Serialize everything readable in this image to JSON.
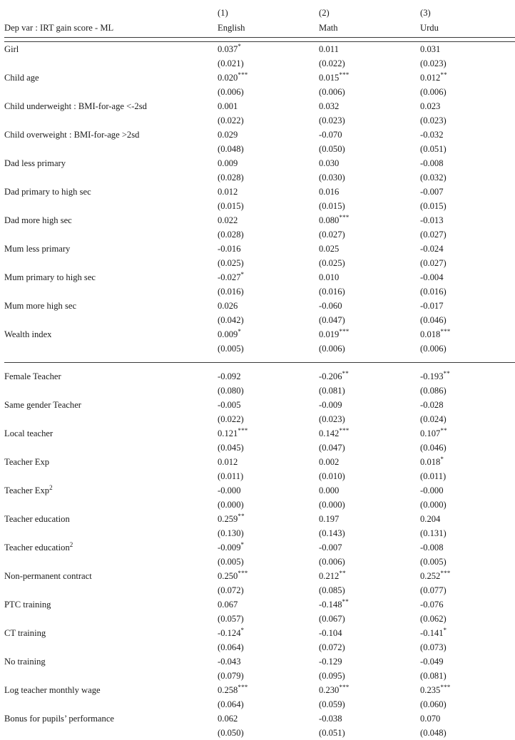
{
  "table": {
    "stub_header": "Dep var : IRT gain score - ML",
    "model_numbers": [
      "(1)",
      "(2)",
      "(3)"
    ],
    "column_headers": [
      "English",
      "Math",
      "Urdu"
    ],
    "panels": [
      {
        "name": "child-household-characteristics",
        "rows": [
          {
            "label": "Girl",
            "coefficients": [
              "0.037",
              "0.011",
              "0.031"
            ],
            "stars": [
              "*",
              "",
              ""
            ],
            "std_errors": [
              "(0.021)",
              "(0.022)",
              "(0.023)"
            ]
          },
          {
            "label": "Child age",
            "coefficients": [
              "0.020",
              "0.015",
              "0.012"
            ],
            "stars": [
              "***",
              "***",
              "**"
            ],
            "std_errors": [
              "(0.006)",
              "(0.006)",
              "(0.006)"
            ]
          },
          {
            "label": "Child underweight : BMI-for-age <-2sd",
            "coefficients": [
              "0.001",
              "0.032",
              "0.023"
            ],
            "stars": [
              "",
              "",
              ""
            ],
            "std_errors": [
              "(0.022)",
              "(0.023)",
              "(0.023)"
            ]
          },
          {
            "label": "Child overweight : BMI-for-age >2sd",
            "coefficients": [
              "0.029",
              "-0.070",
              "-0.032"
            ],
            "stars": [
              "",
              "",
              ""
            ],
            "std_errors": [
              "(0.048)",
              "(0.050)",
              "(0.051)"
            ]
          },
          {
            "label": "Dad less primary",
            "coefficients": [
              "0.009",
              "0.030",
              "-0.008"
            ],
            "stars": [
              "",
              "",
              ""
            ],
            "std_errors": [
              "(0.028)",
              "(0.030)",
              "(0.032)"
            ]
          },
          {
            "label": "Dad primary to high sec",
            "coefficients": [
              "0.012",
              "0.016",
              "-0.007"
            ],
            "stars": [
              "",
              "",
              ""
            ],
            "std_errors": [
              "(0.015)",
              "(0.015)",
              "(0.015)"
            ]
          },
          {
            "label": "Dad more high sec",
            "coefficients": [
              "0.022",
              "0.080",
              "-0.013"
            ],
            "stars": [
              "",
              "***",
              ""
            ],
            "std_errors": [
              "(0.028)",
              "(0.027)",
              "(0.027)"
            ]
          },
          {
            "label": "Mum less primary",
            "coefficients": [
              "-0.016",
              "0.025",
              "-0.024"
            ],
            "stars": [
              "",
              "",
              ""
            ],
            "std_errors": [
              "(0.025)",
              "(0.025)",
              "(0.027)"
            ]
          },
          {
            "label": "Mum primary to high sec",
            "coefficients": [
              "-0.027",
              "0.010",
              "-0.004"
            ],
            "stars": [
              "*",
              "",
              ""
            ],
            "std_errors": [
              "(0.016)",
              "(0.016)",
              "(0.016)"
            ]
          },
          {
            "label": "Mum more high sec",
            "coefficients": [
              "0.026",
              "-0.060",
              "-0.017"
            ],
            "stars": [
              "",
              "",
              ""
            ],
            "std_errors": [
              "(0.042)",
              "(0.047)",
              "(0.046)"
            ]
          },
          {
            "label": "Wealth index",
            "coefficients": [
              "0.009",
              "0.019",
              "0.018"
            ],
            "stars": [
              "*",
              "***",
              "***"
            ],
            "std_errors": [
              "(0.005)",
              "(0.006)",
              "(0.006)"
            ]
          }
        ]
      },
      {
        "name": "teacher-characteristics",
        "rows": [
          {
            "label": "Female Teacher",
            "coefficients": [
              "-0.092",
              "-0.206",
              "-0.193"
            ],
            "stars": [
              "",
              "**",
              "**"
            ],
            "std_errors": [
              "(0.080)",
              "(0.081)",
              "(0.086)"
            ]
          },
          {
            "label": "Same gender Teacher",
            "coefficients": [
              "-0.005",
              "-0.009",
              "-0.028"
            ],
            "stars": [
              "",
              "",
              ""
            ],
            "std_errors": [
              "(0.022)",
              "(0.023)",
              "(0.024)"
            ]
          },
          {
            "label": "Local teacher",
            "coefficients": [
              "0.121",
              "0.142",
              "0.107"
            ],
            "stars": [
              "***",
              "***",
              "**"
            ],
            "std_errors": [
              "(0.045)",
              "(0.047)",
              "(0.046)"
            ]
          },
          {
            "label": "Teacher Exp",
            "coefficients": [
              "0.012",
              "0.002",
              "0.018"
            ],
            "stars": [
              "",
              "",
              "*"
            ],
            "std_errors": [
              "(0.011)",
              "(0.010)",
              "(0.011)"
            ]
          },
          {
            "label": "Teacher Exp",
            "label_superscript": "2",
            "coefficients": [
              "-0.000",
              "0.000",
              "-0.000"
            ],
            "stars": [
              "",
              "",
              ""
            ],
            "std_errors": [
              "(0.000)",
              "(0.000)",
              "(0.000)"
            ]
          },
          {
            "label": "Teacher education",
            "coefficients": [
              "0.259",
              "0.197",
              "0.204"
            ],
            "stars": [
              "**",
              "",
              ""
            ],
            "std_errors": [
              "(0.130)",
              "(0.143)",
              "(0.131)"
            ]
          },
          {
            "label": "Teacher education",
            "label_superscript": "2",
            "coefficients": [
              "-0.009",
              "-0.007",
              "-0.008"
            ],
            "stars": [
              "*",
              "",
              ""
            ],
            "std_errors": [
              "(0.005)",
              "(0.006)",
              "(0.005)"
            ]
          },
          {
            "label": "Non-permanent contract",
            "coefficients": [
              "0.250",
              "0.212",
              "0.252"
            ],
            "stars": [
              "***",
              "**",
              "***"
            ],
            "std_errors": [
              "(0.072)",
              "(0.085)",
              "(0.077)"
            ]
          },
          {
            "label": "PTC training",
            "coefficients": [
              "0.067",
              "-0.148",
              "-0.076"
            ],
            "stars": [
              "",
              "**",
              ""
            ],
            "std_errors": [
              "(0.057)",
              "(0.067)",
              "(0.062)"
            ]
          },
          {
            "label": "CT training",
            "coefficients": [
              "-0.124",
              "-0.104",
              "-0.141"
            ],
            "stars": [
              "*",
              "",
              "*"
            ],
            "std_errors": [
              "(0.064)",
              "(0.072)",
              "(0.073)"
            ]
          },
          {
            "label": "No training",
            "coefficients": [
              "-0.043",
              "-0.129",
              "-0.049"
            ],
            "stars": [
              "",
              "",
              ""
            ],
            "std_errors": [
              "(0.079)",
              "(0.095)",
              "(0.081)"
            ]
          },
          {
            "label": "Log teacher monthly wage",
            "coefficients": [
              "0.258",
              "0.230",
              "0.235"
            ],
            "stars": [
              "***",
              "***",
              "***"
            ],
            "std_errors": [
              "(0.064)",
              "(0.059)",
              "(0.060)"
            ]
          },
          {
            "label": "Bonus for pupils’ performance",
            "coefficients": [
              "0.062",
              "-0.038",
              "0.070"
            ],
            "stars": [
              "",
              "",
              ""
            ],
            "std_errors": [
              "(0.050)",
              "(0.051)",
              "(0.048)"
            ]
          }
        ]
      }
    ]
  }
}
